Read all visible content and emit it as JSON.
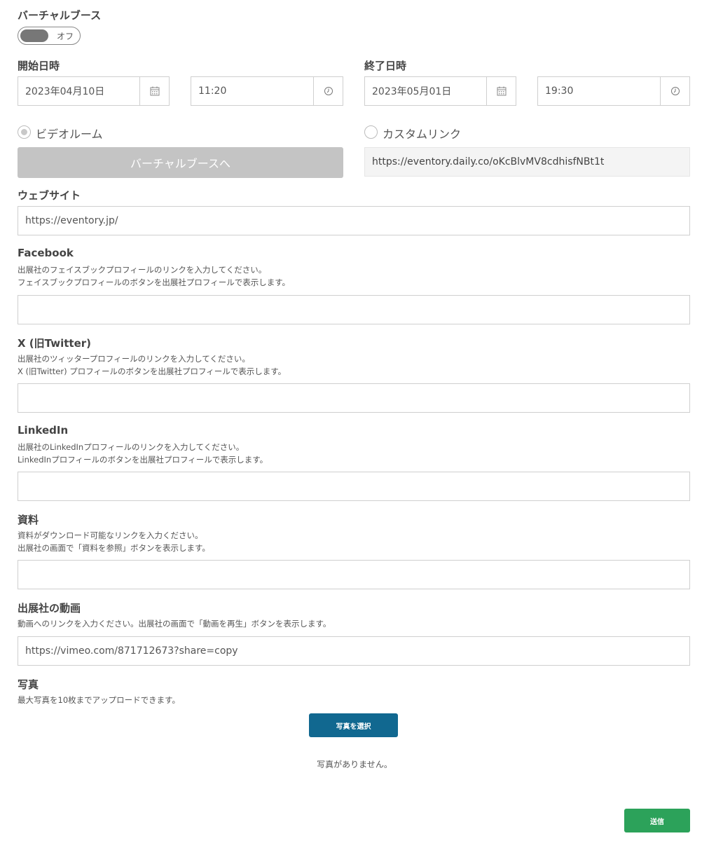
{
  "virtual_booth": {
    "title": "バーチャルブース",
    "toggle_label": "オフ"
  },
  "start": {
    "label": "開始日時",
    "date": "2023年04月10日",
    "time": "11:20"
  },
  "end": {
    "label": "終了日時",
    "date": "2023年05月01日",
    "time": "19:30"
  },
  "room_option": {
    "video_room_label": "ビデオルーム",
    "custom_link_label": "カスタムリンク",
    "booth_button": "バーチャルブースへ",
    "custom_link_value": "https://eventory.daily.co/oKcBlvMV8cdhisfNBt1t"
  },
  "website": {
    "label": "ウェブサイト",
    "value": "https://eventory.jp/"
  },
  "facebook": {
    "label": "Facebook",
    "help1": "出展社のフェイスブックプロフィールのリンクを入力してください。",
    "help2": "フェイスブックプロフィールのボタンを出展社プロフィールで表示します。",
    "value": ""
  },
  "twitter": {
    "label": "X (旧Twitter)",
    "help1": "出展社のツィッタープロフィールのリンクを入力してください。",
    "help2": "X (旧Twitter) プロフィールのボタンを出展社プロフィールで表示します。",
    "value": ""
  },
  "linkedin": {
    "label": "LinkedIn",
    "help1": "出展社のLinkedInプロフィールのリンクを入力してください。",
    "help2": "LinkedInプロフィールのボタンを出展社プロフィールで表示します。",
    "value": ""
  },
  "materials": {
    "label": "資料",
    "help1": "資料がダウンロード可能なリンクを入力ください。",
    "help2": "出展社の画面で「資料を参照」ボタンを表示します。",
    "value": ""
  },
  "video": {
    "label": "出展社の動画",
    "help1": "動画へのリンクを入力ください。出展社の画面で「動画を再生」ボタンを表示します。",
    "value": "https://vimeo.com/871712673?share=copy"
  },
  "photos": {
    "label": "写真",
    "help1": "最大写真を10枚までアップロードできます。",
    "select_button": "写真を選択",
    "empty_text": "写真がありません。"
  },
  "submit_button": "送信",
  "colors": {
    "photo_button": "#116890",
    "submit_button": "#2ca25a",
    "disabled_button": "#c4c4c4"
  },
  "icons": {
    "date": "calendar-icon",
    "time": "clock-icon"
  }
}
